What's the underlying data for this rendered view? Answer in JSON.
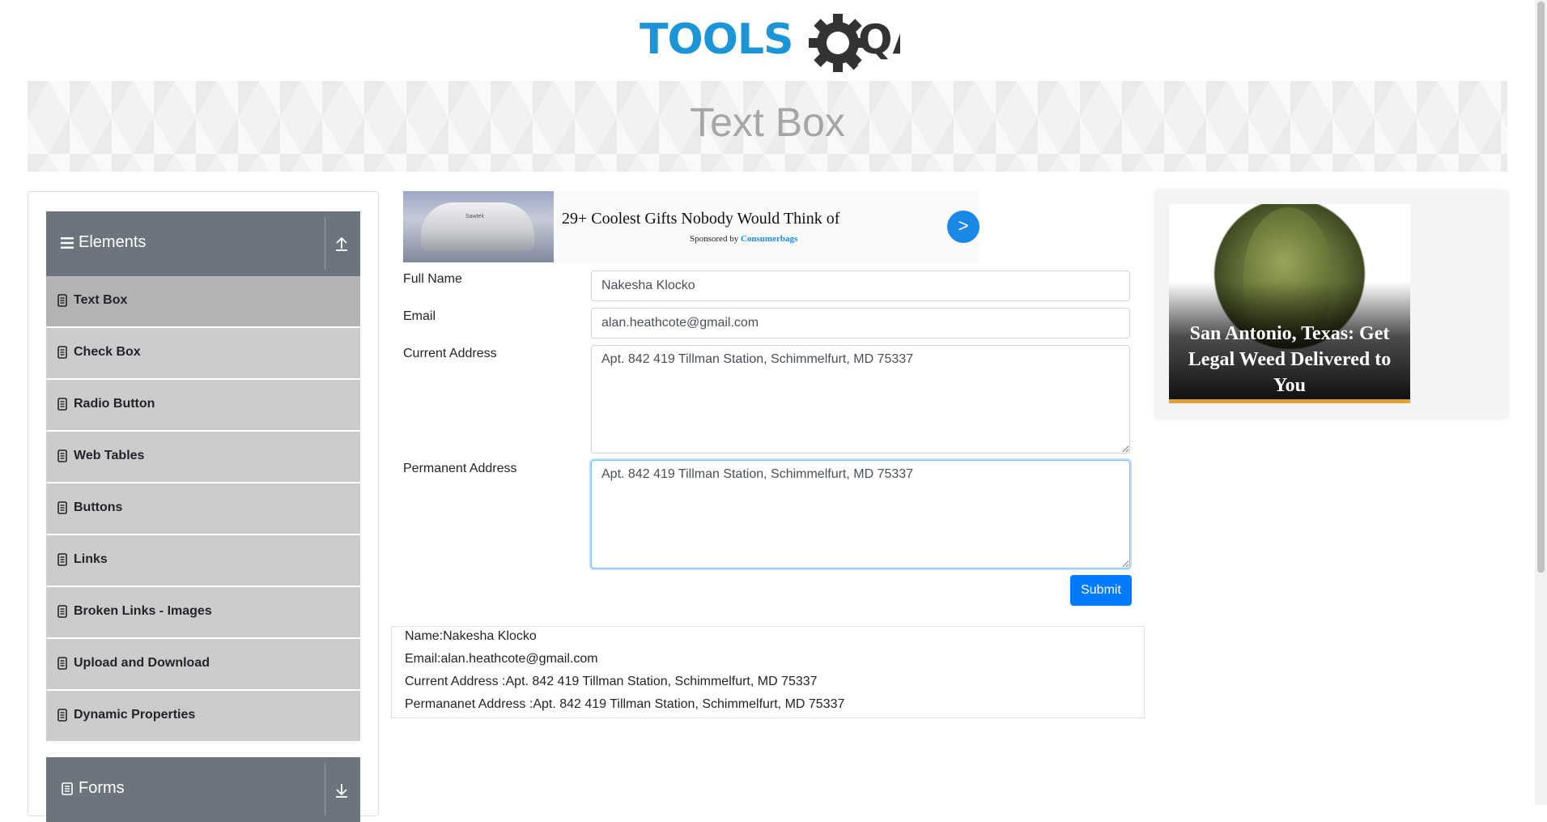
{
  "logo": {
    "text_tools": "TOOLS",
    "text_qa": "QA"
  },
  "banner": {
    "title": "Text Box"
  },
  "sidebar": {
    "elements_group": {
      "label": "Elements",
      "icon": "hamburger-icon",
      "toggle_icon": "collapse-up-icon"
    },
    "items": [
      {
        "label": "Text Box",
        "active": true
      },
      {
        "label": "Check Box"
      },
      {
        "label": "Radio Button"
      },
      {
        "label": "Web Tables"
      },
      {
        "label": "Buttons"
      },
      {
        "label": "Links"
      },
      {
        "label": "Broken Links - Images"
      },
      {
        "label": "Upload and Download"
      },
      {
        "label": "Dynamic Properties"
      }
    ],
    "forms_group": {
      "label": "Forms",
      "icon": "form-icon",
      "toggle_icon": "expand-down-icon"
    }
  },
  "ad_top": {
    "headline": "29+ Coolest Gifts Nobody Would Think of",
    "sponsored_by": "Sponsored by",
    "sponsor": "Consumerbags",
    "arrow": ">",
    "device_label": "Sawtek"
  },
  "form": {
    "full_name_label": "Full Name",
    "full_name_value": "Nakesha Klocko",
    "email_label": "Email",
    "email_value": "alan.heathcote@gmail.com",
    "current_address_label": "Current Address",
    "current_address_value": "Apt. 842 419 Tillman Station, Schimmelfurt, MD 75337",
    "permanent_address_label": "Permanent Address",
    "permanent_address_value": "Apt. 842 419 Tillman Station, Schimmelfurt, MD 75337",
    "submit_label": "Submit"
  },
  "output": {
    "name": "Name:Nakesha Klocko",
    "email": "Email:alan.heathcote@gmail.com",
    "current_address": "Current Address :Apt. 842 419 Tillman Station, Schimmelfurt, MD 75337",
    "permanent_address": "Permananet Address :Apt. 842 419 Tillman Station, Schimmelfurt, MD 75337"
  },
  "ad_right": {
    "text": "San Antonio, Texas: Get Legal Weed Delivered to You"
  },
  "colors": {
    "primary": "#007bff",
    "header_gray": "#6c757d",
    "menu_gray": "#cccccc",
    "logo_blue": "#1b95d6",
    "logo_dark": "#333333"
  }
}
